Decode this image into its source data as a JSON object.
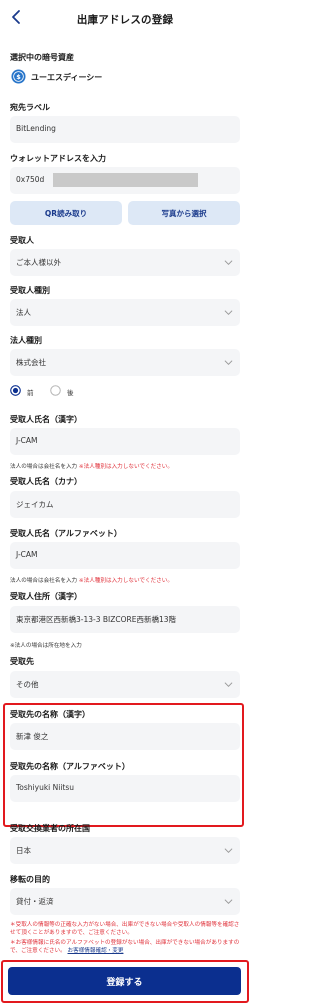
{
  "header": {
    "title": "出庫アドレスの登録"
  },
  "crypto": {
    "label": "選択中の暗号資産",
    "name": "ユーエスディーシー"
  },
  "destination_label": {
    "label": "宛先ラベル",
    "value": "BitLending"
  },
  "wallet": {
    "label": "ウォレットアドレスを入力",
    "value_prefix": "0x750d"
  },
  "buttons": {
    "qr": "QR読み取り",
    "photo": "写真から選択",
    "submit": "登録する"
  },
  "recipient": {
    "label": "受取人",
    "value": "ご本人様以外"
  },
  "recipient_type": {
    "label": "受取人種別",
    "value": "法人"
  },
  "corp_type": {
    "label": "法人種別",
    "value": "株式会社"
  },
  "position": {
    "option_before": "前",
    "option_after": "後",
    "selected": "前"
  },
  "name_kanji": {
    "label": "受取人氏名（漢字）",
    "value": "J-CAM",
    "note": "法人の場合は会社名を入力",
    "warn": "※法人種別は入力しないでください。"
  },
  "name_kana": {
    "label": "受取人氏名（カナ）",
    "value": "ジェイカム"
  },
  "name_alpha": {
    "label": "受取人氏名（アルファベット）",
    "value": "J-CAM",
    "note": "法人の場合は会社名を入力",
    "warn": "※法人種別は入力しないでください。"
  },
  "address": {
    "label": "受取人住所（漢字）",
    "value": "東京都港区西新橋3-13-3 BIZCORE西新橋13階",
    "note": "※法人の場合は所在地を入力"
  },
  "receiver": {
    "label": "受取先",
    "value": "その他"
  },
  "receiver_name_kanji": {
    "label": "受取先の名称（漢字）",
    "value": "新津 俊之"
  },
  "receiver_name_alpha": {
    "label": "受取先の名称（アルファベット）",
    "value": "Toshiyuki Niitsu"
  },
  "exchange_country": {
    "label": "受取交換業者の所在国",
    "value": "日本"
  },
  "purpose": {
    "label": "移転の目的",
    "value": "貸付・返済"
  },
  "notices": {
    "n1": "＊受取人の情報等の正確な入力がない場合、出庫ができない場合や受取人の情報等を確認させて頂くことがありますので、ご注意ください。",
    "n2": "＊お客様情報に氏名のアルファベットの登録がない場合、出庫ができない場合がありますので、ご注意ください。",
    "n2_link": "お客様情報確認・変更"
  },
  "colors": {
    "primary": "#0b2f8f",
    "warn": "#e0313a",
    "highlight": "#e2191e",
    "usdc": "#2775ca"
  },
  "icons": {
    "back": "chevron-left-icon",
    "dropdown": "chevron-down-icon",
    "currency": "usdc-coin-icon"
  }
}
